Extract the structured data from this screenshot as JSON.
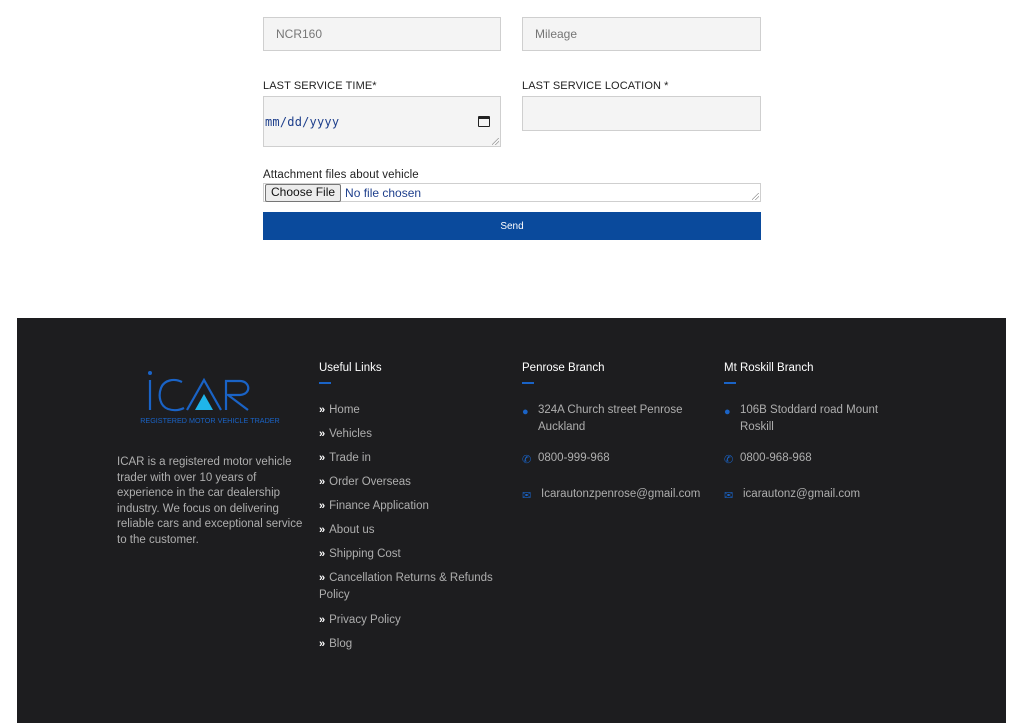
{
  "form": {
    "registration_value": "NCR160",
    "mileage_placeholder": "Mileage",
    "last_service_time_label": "LAST SERVICE TIME*",
    "last_service_time_placeholder": "mm/dd/yyyy",
    "last_service_location_label": "LAST SERVICE LOCATION *",
    "last_service_location_value": "",
    "attachment_label": "Attachment files about vehicle",
    "choose_file_label": "Choose File",
    "no_file_text": "No file chosen",
    "send_label": "Send"
  },
  "footer": {
    "logo_text": "iCAR",
    "logo_tagline": "REGISTERED MOTOR VEHICLE TRADER",
    "about": "ICAR is a registered motor vehicle trader with over 10 years of experience in the car dealership industry. We focus on delivering reliable cars and exceptional service to the customer.",
    "useful_links_title": "Useful Links",
    "links": [
      "Home",
      "Vehicles",
      "Trade in",
      "Order Overseas",
      "Finance Application",
      "About us",
      "Shipping Cost",
      "Cancellation Returns & Refunds Policy",
      "Privacy Policy",
      "Blog"
    ],
    "penrose": {
      "title": "Penrose Branch",
      "address": "324A Church street Penrose Auckland",
      "phone": "0800-999-968",
      "email": "Icarautonzpenrose@gmail.com"
    },
    "roskill": {
      "title": "Mt Roskill Branch",
      "address": "106B Stoddard road Mount Roskill",
      "phone": "0800-968-968",
      "email": "icarautonz@gmail.com"
    }
  },
  "colors": {
    "accent": "#0a4a9c",
    "icon_blue": "#1a63c6",
    "footer_bg": "#1d1d1f"
  }
}
